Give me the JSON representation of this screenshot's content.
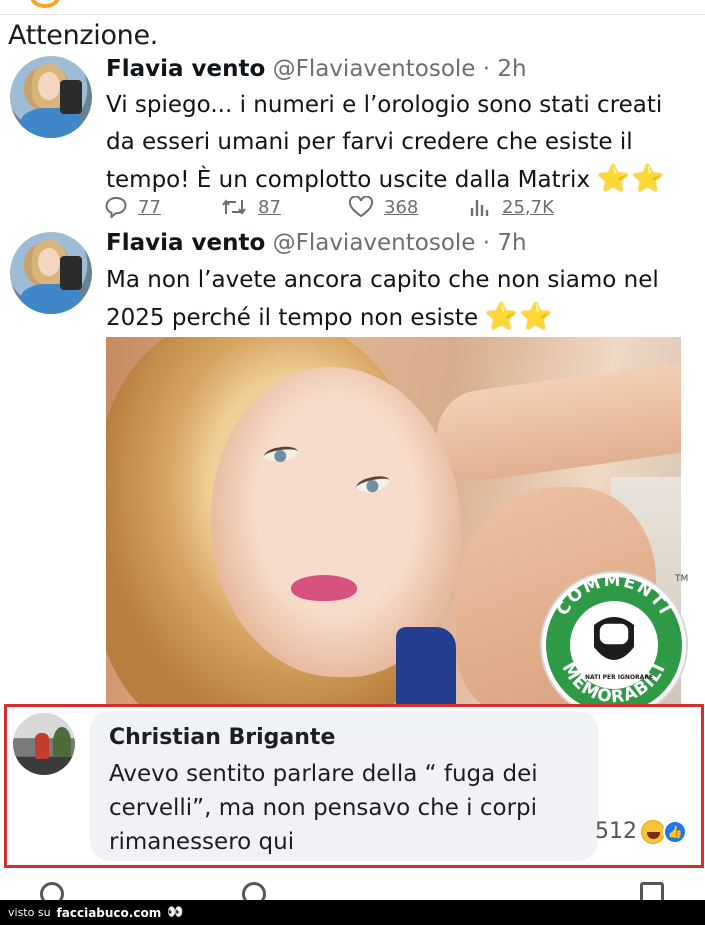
{
  "heading": "Attenzione.",
  "tweets": [
    {
      "name": "Flavia vento",
      "handle": "@Flaviaventosole",
      "time": "· 2h",
      "text": "Vi spiego... i numeri e l’orologio sono stati creati da esseri umani per farvi credere che esiste il tempo! È un complotto uscite dalla Matrix",
      "stars": "⭐⭐",
      "replies": "77",
      "retweets": "87",
      "likes": "368",
      "views": "25,7K"
    },
    {
      "name": "Flavia vento",
      "handle": "@Flaviaventosole",
      "time": "· 7h",
      "text": "Ma non l’avete ancora capito che non siamo nel 2025 perché il tempo non esiste",
      "stars": "⭐⭐"
    }
  ],
  "badge": {
    "top_text": "COMMENTI",
    "bottom_text": "MEMORABILI",
    "small_text": "NATI PER IGNORARE",
    "tm": "TM"
  },
  "comment": {
    "name": "Christian Brigante",
    "text": "Avevo sentito parlare della “ fuga dei cervelli”, ma non pensavo che i corpi rimanessero qui",
    "reaction_count": "512"
  },
  "footer": {
    "prefix": "visto su",
    "brand": "facciabuco.com",
    "eyes": "👀"
  },
  "colors": {
    "highlight_border": "#d32f2f",
    "badge_green": "#2e9a46",
    "handle_gray": "#6a6f74"
  }
}
